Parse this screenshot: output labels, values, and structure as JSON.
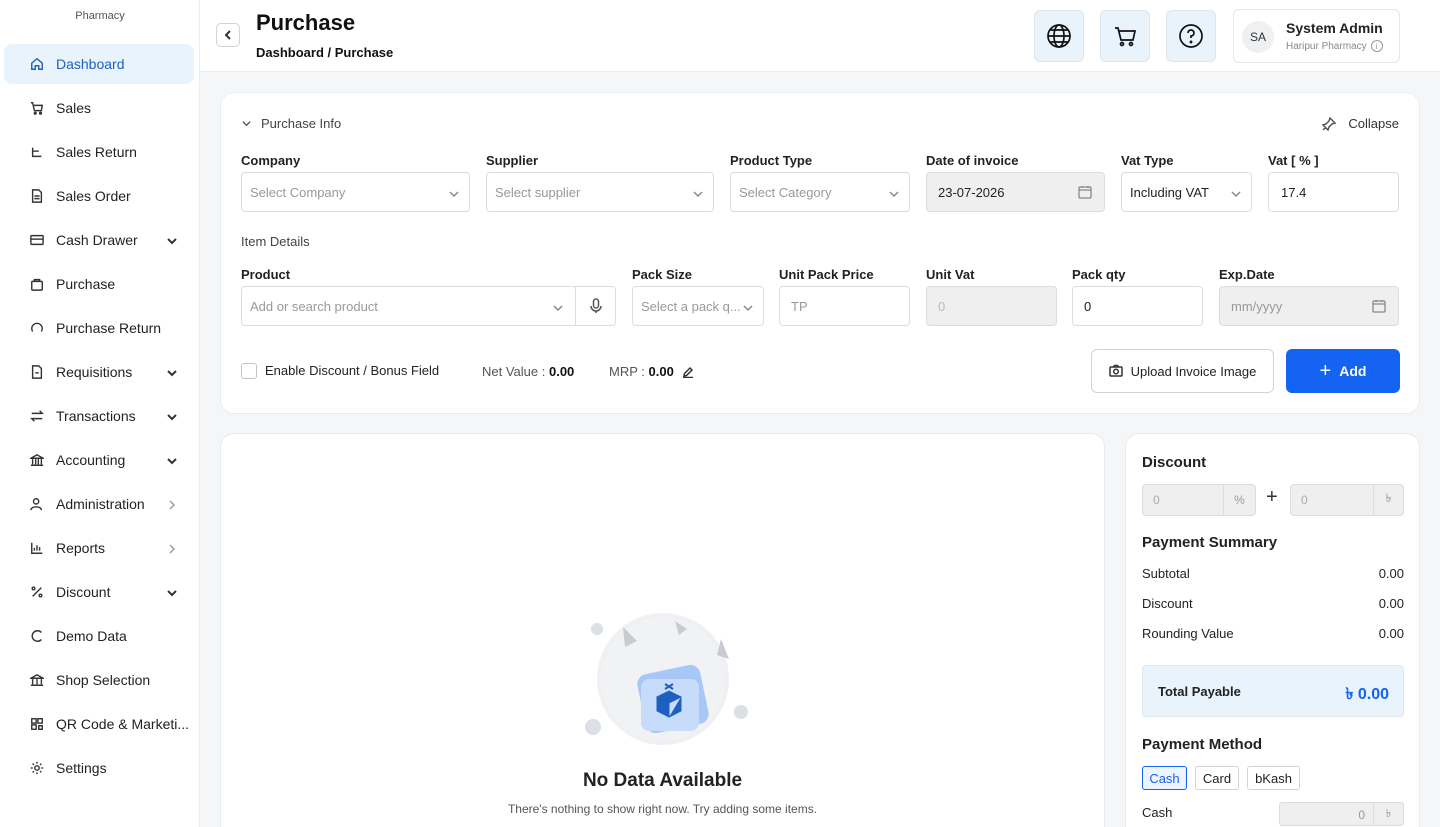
{
  "brand": {
    "name": "Pharmacy"
  },
  "sidebar": {
    "items": [
      {
        "label": "Dashboard",
        "icon": "home-icon"
      },
      {
        "label": "Sales",
        "icon": "cart-icon"
      },
      {
        "label": "Sales Return",
        "icon": "return-icon"
      },
      {
        "label": "Sales Order",
        "icon": "document-icon"
      },
      {
        "label": "Cash Drawer",
        "icon": "drawer-icon"
      },
      {
        "label": "Purchase",
        "icon": "bag-icon"
      },
      {
        "label": "Purchase Return",
        "icon": "refresh-icon"
      },
      {
        "label": "Requisitions",
        "icon": "file-icon"
      },
      {
        "label": "Transactions",
        "icon": "swap-icon"
      },
      {
        "label": "Accounting",
        "icon": "bank-icon"
      },
      {
        "label": "Administration",
        "icon": "user-gear-icon"
      },
      {
        "label": "Reports",
        "icon": "chart-icon"
      },
      {
        "label": "Discount",
        "icon": "percent-icon"
      },
      {
        "label": "Demo Data",
        "icon": "cycle-icon"
      },
      {
        "label": "Shop Selection",
        "icon": "store-icon"
      },
      {
        "label": "QR Code & Marketi...",
        "icon": "qr-icon"
      },
      {
        "label": "Settings",
        "icon": "gear-icon"
      }
    ]
  },
  "header": {
    "title": "Purchase",
    "breadcrumb": "Dashboard / Purchase",
    "user": {
      "initials": "SA",
      "name": "System Admin",
      "shop": "Haripur Pharmacy"
    }
  },
  "purchase_info": {
    "section_title": "Purchase Info",
    "collapse_label": "Collapse",
    "company": {
      "label": "Company",
      "placeholder": "Select Company"
    },
    "supplier": {
      "label": "Supplier",
      "placeholder": "Select supplier"
    },
    "product_type": {
      "label": "Product Type",
      "placeholder": "Select Category"
    },
    "date_of_invoice": {
      "label": "Date of invoice",
      "value": "23-07-2026"
    },
    "vat_type": {
      "label": "Vat Type",
      "value": "Including VAT"
    },
    "vat_percent": {
      "label": "Vat [ % ]",
      "value": "17.4"
    },
    "item_details_title": "Item Details",
    "product": {
      "label": "Product",
      "placeholder": "Add or search product"
    },
    "pack_size": {
      "label": "Pack Size",
      "placeholder": "Select a pack q..."
    },
    "unit_pack_price": {
      "label": "Unit Pack Price",
      "placeholder": "TP"
    },
    "unit_vat": {
      "label": "Unit Vat",
      "value": "0"
    },
    "pack_qty": {
      "label": "Pack qty",
      "value": "0"
    },
    "exp_date": {
      "label": "Exp.Date",
      "placeholder": "mm/yyyy"
    },
    "discount_toggle_label": "Enable Discount / Bonus Field",
    "net_value_label": "Net Value :",
    "net_value": "0.00",
    "mrp_label": "MRP :",
    "mrp": "0.00",
    "upload_label": "Upload Invoice Image",
    "add_label": "Add"
  },
  "empty_state": {
    "title": "No Data Available",
    "subtitle": "There's nothing to show right now. Try adding some items."
  },
  "summary": {
    "discount_title": "Discount",
    "discount_percent": {
      "value": "0",
      "suffix": "%"
    },
    "discount_amount": {
      "value": "0",
      "suffix": "৳"
    },
    "payment_summary_title": "Payment Summary",
    "rows": [
      {
        "label": "Subtotal",
        "value": "0.00"
      },
      {
        "label": "Discount",
        "value": "0.00"
      },
      {
        "label": "Rounding Value",
        "value": "0.00"
      }
    ],
    "total_label": "Total Payable",
    "total_value": "৳ 0.00",
    "payment_method_title": "Payment Method",
    "methods": [
      "Cash",
      "Card",
      "bKash"
    ],
    "cash_label": "Cash",
    "cash_value": "0",
    "cash_suffix": "৳"
  },
  "colors": {
    "accent": "#1463f3",
    "active_bg": "#e9f3fc"
  }
}
